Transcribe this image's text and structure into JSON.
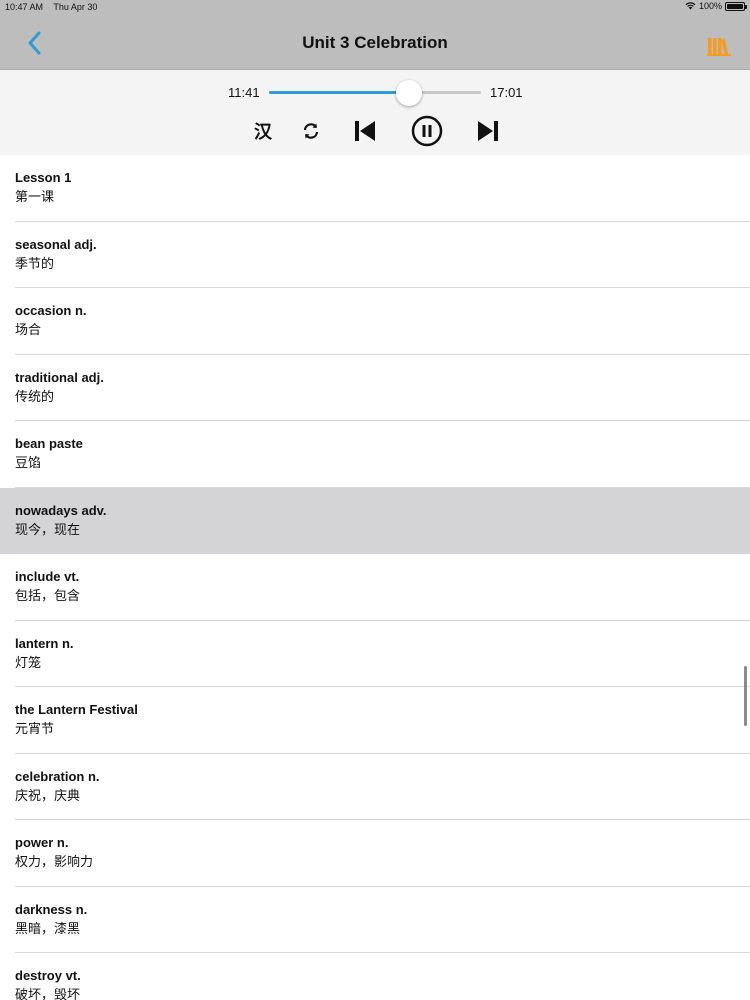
{
  "status_bar": {
    "time": "10:47 AM",
    "date": "Thu Apr 30",
    "battery": "100%"
  },
  "nav": {
    "title": "Unit 3 Celebration",
    "back_icon": "chevron-left-icon",
    "library_icon": "books-icon",
    "accent_color": "#f39c1f",
    "back_color": "#2d9bd8"
  },
  "player": {
    "current_time": "11:41",
    "total_time": "17:01",
    "progress": 0.66,
    "han_label": "汉",
    "controls": [
      "repeat-icon",
      "previous-track-icon",
      "pause-icon",
      "next-track-icon"
    ]
  },
  "words": [
    {
      "en": "Lesson 1",
      "zh": "第一课"
    },
    {
      "en": "seasonal adj.",
      "zh": "季节的"
    },
    {
      "en": "occasion n.",
      "zh": "场合"
    },
    {
      "en": "traditional adj.",
      "zh": "传统的"
    },
    {
      "en": "bean paste",
      "zh": "豆馅"
    },
    {
      "en": "nowadays adv.",
      "zh": "现今，现在",
      "active": true
    },
    {
      "en": "include vt.",
      "zh": "包括，包含"
    },
    {
      "en": "lantern n.",
      "zh": "灯笼"
    },
    {
      "en": "the Lantern Festival",
      "zh": "元宵节"
    },
    {
      "en": "celebration n.",
      "zh": "庆祝，庆典"
    },
    {
      "en": "power n.",
      "zh": "权力，影响力"
    },
    {
      "en": "darkness n.",
      "zh": "黑暗，漆黑"
    },
    {
      "en": "destroy vt.",
      "zh": "破坏，毁坏"
    }
  ]
}
